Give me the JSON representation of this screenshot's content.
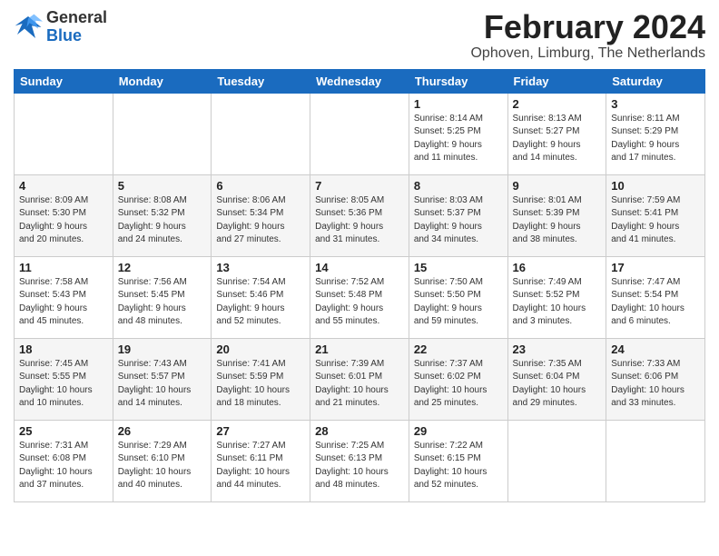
{
  "header": {
    "logo": {
      "general": "General",
      "blue": "Blue"
    },
    "title": "February 2024",
    "location": "Ophoven, Limburg, The Netherlands"
  },
  "calendar": {
    "days_of_week": [
      "Sunday",
      "Monday",
      "Tuesday",
      "Wednesday",
      "Thursday",
      "Friday",
      "Saturday"
    ],
    "weeks": [
      [
        {
          "day": "",
          "info": ""
        },
        {
          "day": "",
          "info": ""
        },
        {
          "day": "",
          "info": ""
        },
        {
          "day": "",
          "info": ""
        },
        {
          "day": "1",
          "info": "Sunrise: 8:14 AM\nSunset: 5:25 PM\nDaylight: 9 hours\nand 11 minutes."
        },
        {
          "day": "2",
          "info": "Sunrise: 8:13 AM\nSunset: 5:27 PM\nDaylight: 9 hours\nand 14 minutes."
        },
        {
          "day": "3",
          "info": "Sunrise: 8:11 AM\nSunset: 5:29 PM\nDaylight: 9 hours\nand 17 minutes."
        }
      ],
      [
        {
          "day": "4",
          "info": "Sunrise: 8:09 AM\nSunset: 5:30 PM\nDaylight: 9 hours\nand 20 minutes."
        },
        {
          "day": "5",
          "info": "Sunrise: 8:08 AM\nSunset: 5:32 PM\nDaylight: 9 hours\nand 24 minutes."
        },
        {
          "day": "6",
          "info": "Sunrise: 8:06 AM\nSunset: 5:34 PM\nDaylight: 9 hours\nand 27 minutes."
        },
        {
          "day": "7",
          "info": "Sunrise: 8:05 AM\nSunset: 5:36 PM\nDaylight: 9 hours\nand 31 minutes."
        },
        {
          "day": "8",
          "info": "Sunrise: 8:03 AM\nSunset: 5:37 PM\nDaylight: 9 hours\nand 34 minutes."
        },
        {
          "day": "9",
          "info": "Sunrise: 8:01 AM\nSunset: 5:39 PM\nDaylight: 9 hours\nand 38 minutes."
        },
        {
          "day": "10",
          "info": "Sunrise: 7:59 AM\nSunset: 5:41 PM\nDaylight: 9 hours\nand 41 minutes."
        }
      ],
      [
        {
          "day": "11",
          "info": "Sunrise: 7:58 AM\nSunset: 5:43 PM\nDaylight: 9 hours\nand 45 minutes."
        },
        {
          "day": "12",
          "info": "Sunrise: 7:56 AM\nSunset: 5:45 PM\nDaylight: 9 hours\nand 48 minutes."
        },
        {
          "day": "13",
          "info": "Sunrise: 7:54 AM\nSunset: 5:46 PM\nDaylight: 9 hours\nand 52 minutes."
        },
        {
          "day": "14",
          "info": "Sunrise: 7:52 AM\nSunset: 5:48 PM\nDaylight: 9 hours\nand 55 minutes."
        },
        {
          "day": "15",
          "info": "Sunrise: 7:50 AM\nSunset: 5:50 PM\nDaylight: 9 hours\nand 59 minutes."
        },
        {
          "day": "16",
          "info": "Sunrise: 7:49 AM\nSunset: 5:52 PM\nDaylight: 10 hours\nand 3 minutes."
        },
        {
          "day": "17",
          "info": "Sunrise: 7:47 AM\nSunset: 5:54 PM\nDaylight: 10 hours\nand 6 minutes."
        }
      ],
      [
        {
          "day": "18",
          "info": "Sunrise: 7:45 AM\nSunset: 5:55 PM\nDaylight: 10 hours\nand 10 minutes."
        },
        {
          "day": "19",
          "info": "Sunrise: 7:43 AM\nSunset: 5:57 PM\nDaylight: 10 hours\nand 14 minutes."
        },
        {
          "day": "20",
          "info": "Sunrise: 7:41 AM\nSunset: 5:59 PM\nDaylight: 10 hours\nand 18 minutes."
        },
        {
          "day": "21",
          "info": "Sunrise: 7:39 AM\nSunset: 6:01 PM\nDaylight: 10 hours\nand 21 minutes."
        },
        {
          "day": "22",
          "info": "Sunrise: 7:37 AM\nSunset: 6:02 PM\nDaylight: 10 hours\nand 25 minutes."
        },
        {
          "day": "23",
          "info": "Sunrise: 7:35 AM\nSunset: 6:04 PM\nDaylight: 10 hours\nand 29 minutes."
        },
        {
          "day": "24",
          "info": "Sunrise: 7:33 AM\nSunset: 6:06 PM\nDaylight: 10 hours\nand 33 minutes."
        }
      ],
      [
        {
          "day": "25",
          "info": "Sunrise: 7:31 AM\nSunset: 6:08 PM\nDaylight: 10 hours\nand 37 minutes."
        },
        {
          "day": "26",
          "info": "Sunrise: 7:29 AM\nSunset: 6:10 PM\nDaylight: 10 hours\nand 40 minutes."
        },
        {
          "day": "27",
          "info": "Sunrise: 7:27 AM\nSunset: 6:11 PM\nDaylight: 10 hours\nand 44 minutes."
        },
        {
          "day": "28",
          "info": "Sunrise: 7:25 AM\nSunset: 6:13 PM\nDaylight: 10 hours\nand 48 minutes."
        },
        {
          "day": "29",
          "info": "Sunrise: 7:22 AM\nSunset: 6:15 PM\nDaylight: 10 hours\nand 52 minutes."
        },
        {
          "day": "",
          "info": ""
        },
        {
          "day": "",
          "info": ""
        }
      ]
    ]
  }
}
